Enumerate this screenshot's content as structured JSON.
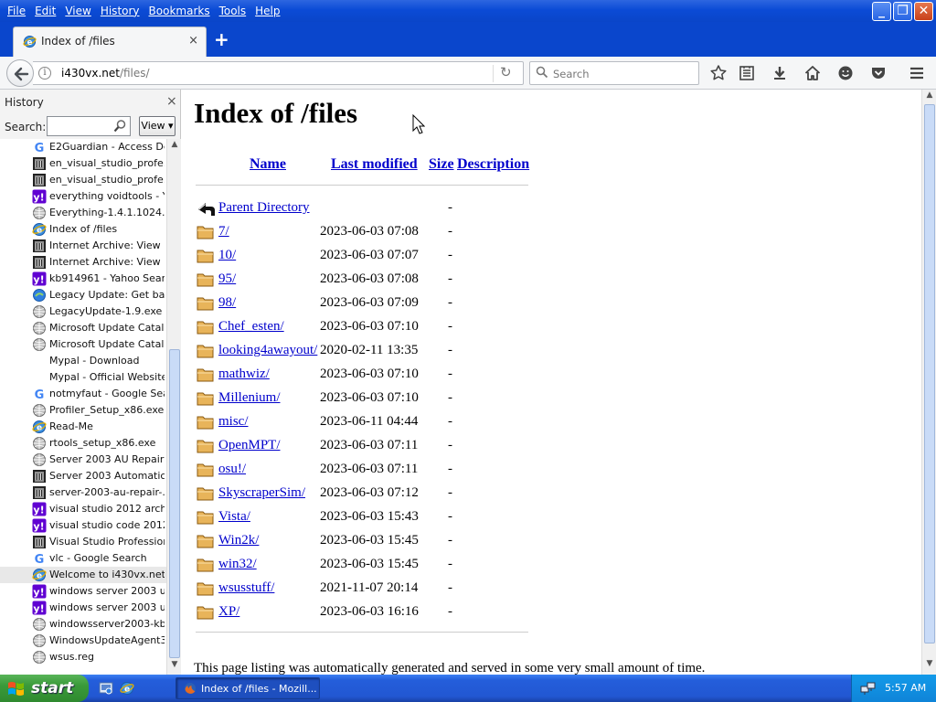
{
  "menu": [
    "File",
    "Edit",
    "View",
    "History",
    "Bookmarks",
    "Tools",
    "Help"
  ],
  "tab": {
    "title": "Index of /files",
    "close": "×"
  },
  "new_tab": "+",
  "nav": {
    "url_host": "i430vx.net",
    "url_path": "/files/",
    "search_placeholder": "Search"
  },
  "sidebar": {
    "title": "History",
    "close": "×",
    "search_label": "Search:",
    "view_label": "View",
    "items": [
      {
        "label": "E2Guardian - Access De...",
        "icon": "google"
      },
      {
        "label": "en_visual_studio_profe...",
        "icon": "archive"
      },
      {
        "label": "en_visual_studio_profe...",
        "icon": "archive"
      },
      {
        "label": "everything voidtools - Y...",
        "icon": "yahoo"
      },
      {
        "label": "Everything-1.4.1.1024....",
        "icon": "globe"
      },
      {
        "label": "Index of /files",
        "icon": "ie"
      },
      {
        "label": "Internet Archive: View ...",
        "icon": "archive"
      },
      {
        "label": "Internet Archive: View ...",
        "icon": "archive"
      },
      {
        "label": "kb914961 - Yahoo Sear...",
        "icon": "yahoo"
      },
      {
        "label": "Legacy Update: Get ba...",
        "icon": "legacy"
      },
      {
        "label": "LegacyUpdate-1.9.exe",
        "icon": "globe"
      },
      {
        "label": "Microsoft Update Catalog",
        "icon": "globe"
      },
      {
        "label": "Microsoft Update Catalog",
        "icon": "globe"
      },
      {
        "label": "Mypal - Download",
        "icon": "none"
      },
      {
        "label": "Mypal - Official Website",
        "icon": "none"
      },
      {
        "label": "notmyfaut - Google Sea...",
        "icon": "google"
      },
      {
        "label": "Profiler_Setup_x86.exe",
        "icon": "globe"
      },
      {
        "label": "Read-Me",
        "icon": "ie"
      },
      {
        "label": "rtools_setup_x86.exe",
        "icon": "globe"
      },
      {
        "label": "Server 2003 AU Repair ...",
        "icon": "globe"
      },
      {
        "label": "Server 2003 Automatic ...",
        "icon": "archive"
      },
      {
        "label": "server-2003-au-repair-...",
        "icon": "archive"
      },
      {
        "label": "visual studio 2012 archi...",
        "icon": "yahoo"
      },
      {
        "label": "visual studio code 2012 ...",
        "icon": "yahoo"
      },
      {
        "label": "Visual Studio Profession...",
        "icon": "archive"
      },
      {
        "label": "vlc - Google Search",
        "icon": "google"
      },
      {
        "label": "Welcome to i430vx.net!",
        "icon": "ie",
        "selected": true
      },
      {
        "label": "windows server 2003 u...",
        "icon": "yahoo"
      },
      {
        "label": "windows server 2003 u...",
        "icon": "yahoo"
      },
      {
        "label": "windowsserver2003-kb...",
        "icon": "globe"
      },
      {
        "label": "WindowsUpdateAgent3...",
        "icon": "globe"
      },
      {
        "label": "wsus.reg",
        "icon": "globe"
      }
    ]
  },
  "page": {
    "heading": "Index of /files",
    "columns": {
      "name": "Name",
      "modified": "Last modified",
      "size": "Size",
      "description": "Description"
    },
    "parent": {
      "name": "Parent Directory",
      "size": "-"
    },
    "rows": [
      {
        "name": "7/",
        "modified": "2023-06-03 07:08",
        "size": "-"
      },
      {
        "name": "10/",
        "modified": "2023-06-03 07:07",
        "size": "-"
      },
      {
        "name": "95/",
        "modified": "2023-06-03 07:08",
        "size": "-"
      },
      {
        "name": "98/",
        "modified": "2023-06-03 07:09",
        "size": "-"
      },
      {
        "name": "Chef_esten/",
        "modified": "2023-06-03 07:10",
        "size": "-"
      },
      {
        "name": "looking4awayout/",
        "modified": "2020-02-11 13:35",
        "size": "-"
      },
      {
        "name": "mathwiz/",
        "modified": "2023-06-03 07:10",
        "size": "-"
      },
      {
        "name": "Millenium/",
        "modified": "2023-06-03 07:10",
        "size": "-"
      },
      {
        "name": "misc/",
        "modified": "2023-06-11 04:44",
        "size": "-"
      },
      {
        "name": "OpenMPT/",
        "modified": "2023-06-03 07:11",
        "size": "-"
      },
      {
        "name": "osu!/",
        "modified": "2023-06-03 07:11",
        "size": "-"
      },
      {
        "name": "SkyscraperSim/",
        "modified": "2023-06-03 07:12",
        "size": "-"
      },
      {
        "name": "Vista/",
        "modified": "2023-06-03 15:43",
        "size": "-"
      },
      {
        "name": "Win2k/",
        "modified": "2023-06-03 15:45",
        "size": "-"
      },
      {
        "name": "win32/",
        "modified": "2023-06-03 15:45",
        "size": "-"
      },
      {
        "name": "wsusstuff/",
        "modified": "2021-11-07 20:14",
        "size": "-"
      },
      {
        "name": "XP/",
        "modified": "2023-06-03 16:16",
        "size": "-"
      }
    ],
    "footer": "This page listing was automatically generated and served in some very small amount of time."
  },
  "taskbar": {
    "start": "start",
    "task_title": "Index of /files - Mozill...",
    "clock": "5:57 AM"
  },
  "colors": {
    "link": "#0000cc",
    "titlebar": "#0b4bd6",
    "taskbar": "#245edb",
    "start": "#3a9a3a",
    "folder": "#e8b45a"
  }
}
